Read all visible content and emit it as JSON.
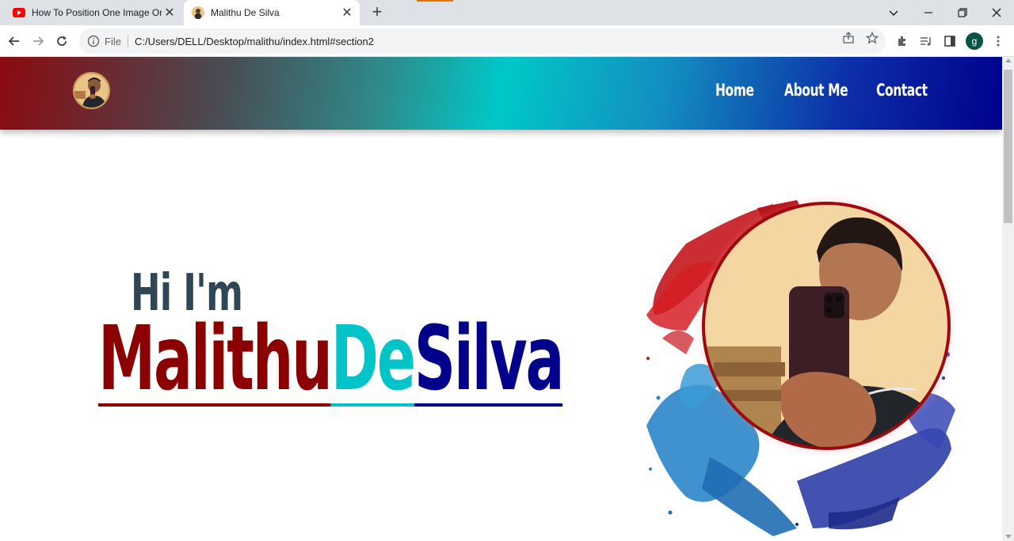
{
  "browser": {
    "tabs": [
      {
        "title": "How To Position One Image On T",
        "active": false,
        "favicon": "youtube-icon"
      },
      {
        "title": "Malithu De Silva",
        "active": true,
        "favicon": "avatar-favicon"
      }
    ],
    "address": {
      "scheme_label": "File",
      "url": "C:/Users/DELL/Desktop/malithu/index.html#section2"
    },
    "profile_initial": "g"
  },
  "site": {
    "nav": [
      {
        "label": "Home"
      },
      {
        "label": "About Me"
      },
      {
        "label": "Contact"
      }
    ],
    "hero": {
      "greeting": "Hi I'm",
      "name_part1": "Malithu",
      "name_part2": "De",
      "name_part3": "Silva"
    },
    "colors": {
      "name_part1": "#8b0000",
      "name_part2": "#00c4c8",
      "name_part3": "#00008b",
      "greeting": "#2f4656"
    }
  }
}
